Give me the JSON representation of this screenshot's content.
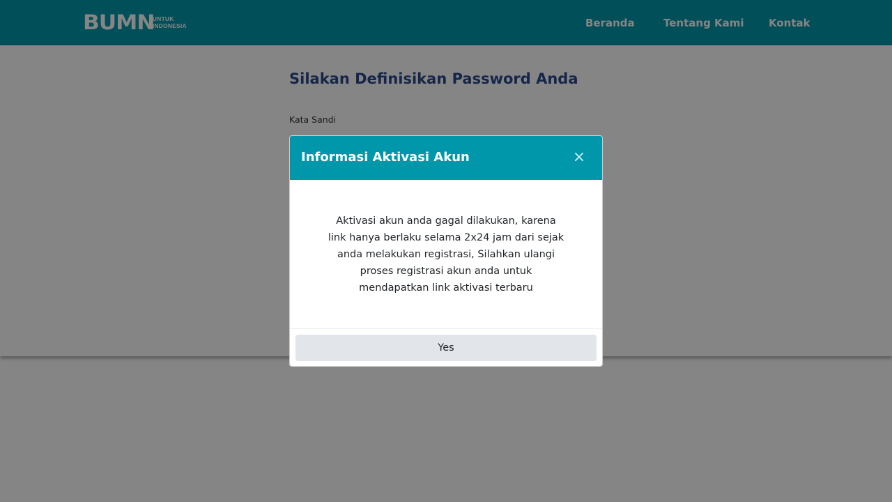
{
  "header": {
    "logo": {
      "mark": "BUMN",
      "line1": "UNTUK",
      "line2": "INDONESIA"
    },
    "nav": [
      {
        "label": "Beranda"
      },
      {
        "label": "Tentang Kami"
      },
      {
        "label": "Kontak"
      }
    ]
  },
  "form": {
    "title": "Silakan Definisikan Password Anda",
    "password_label": "Kata Sandi"
  },
  "modal": {
    "title": "Informasi Aktivasi Akun",
    "close_symbol": "×",
    "message": "Aktivasi akun anda gagal dilakukan, karena link hanya berlaku selama 2x24 jam dari sejak anda melakukan registrasi, Silahkan ulangi proses registrasi akun anda untuk mendapatkan link aktivasi terbaru",
    "confirm_label": "Yes"
  },
  "colors": {
    "brand": "#0097ab",
    "title": "#2b4a8c"
  }
}
